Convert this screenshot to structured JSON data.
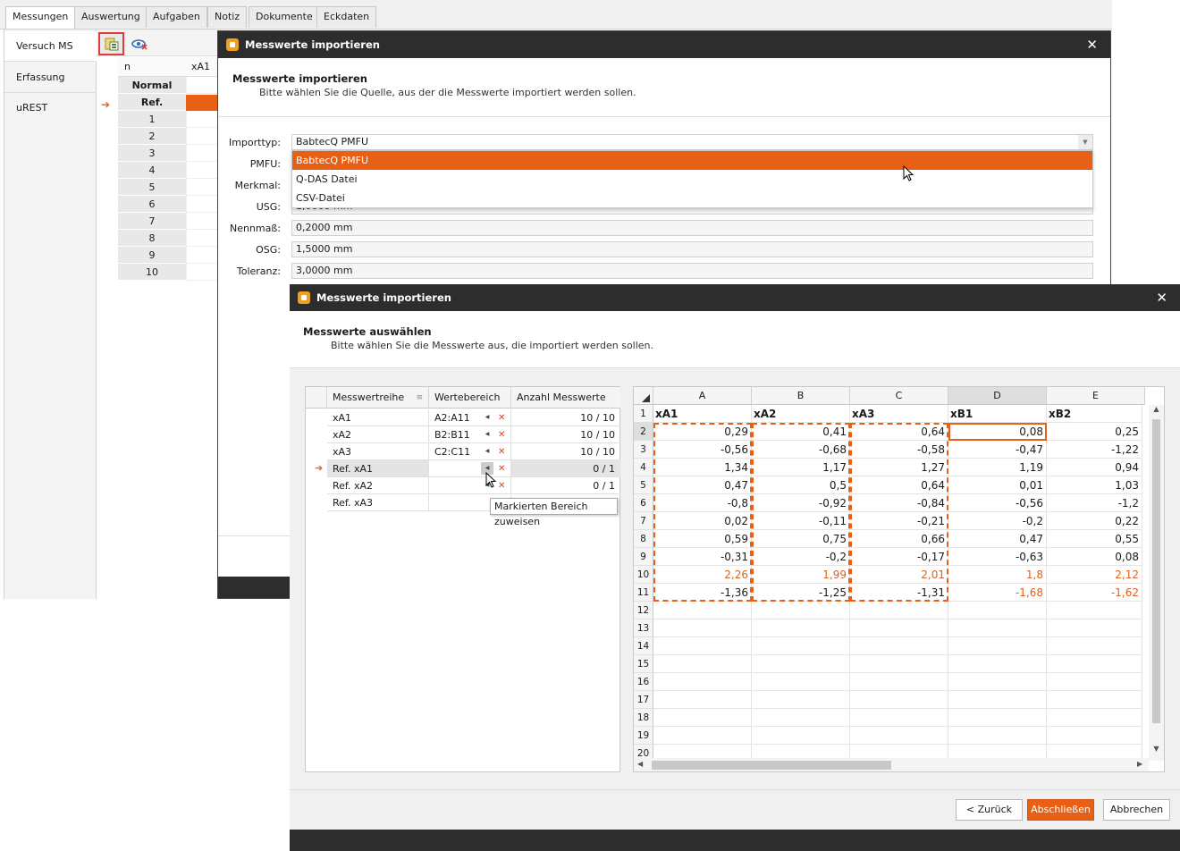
{
  "app": {
    "tabs": [
      "Messungen",
      "Auswertung",
      "Aufgaben",
      "Notiz",
      "Dokumente",
      "Eckdaten"
    ],
    "left_items": [
      "Versuch MS",
      "Erfassung uREST"
    ],
    "grid_head": [
      "n",
      "xA1"
    ],
    "grid_rows": [
      "Normal",
      "Ref.",
      "1",
      "2",
      "3",
      "4",
      "5",
      "6",
      "7",
      "8",
      "9",
      "10"
    ]
  },
  "dialog1": {
    "title": "Messwerte importieren",
    "heading": "Messwerte importieren",
    "subheading": "Bitte wählen Sie die Quelle, aus der die Messwerte importiert werden sollen.",
    "fields": [
      {
        "label": "Importtyp:",
        "value": "BabtecQ PMFU"
      },
      {
        "label": "PMFU:",
        "value": ""
      },
      {
        "label": "Merkmal:",
        "value": ""
      },
      {
        "label": "USG:",
        "value": "1,0000 mm"
      },
      {
        "label": "Nennmaß:",
        "value": "0,2000 mm"
      },
      {
        "label": "OSG:",
        "value": "1,5000 mm"
      },
      {
        "label": "Toleranz:",
        "value": "3,0000 mm"
      }
    ],
    "dropdown_options": [
      "BabtecQ PMFU",
      "Q-DAS Datei",
      "CSV-Datei"
    ],
    "selected_option": "BabtecQ PMFU"
  },
  "dialog2": {
    "title": "Messwerte importieren",
    "heading": "Messwerte auswählen",
    "subheading": "Bitte wählen Sie die Messwerte aus, die importiert werden sollen.",
    "table_headers": [
      "Messwertreihe",
      "Wertebereich",
      "Anzahl Messwerte"
    ],
    "rows": [
      {
        "name": "xA1",
        "range": "A2:A11",
        "count": "10 / 10"
      },
      {
        "name": "xA2",
        "range": "B2:B11",
        "count": "10 / 10"
      },
      {
        "name": "xA3",
        "range": "C2:C11",
        "count": "10 / 10"
      },
      {
        "name": "Ref. xA1",
        "range": "",
        "count": "0 / 1"
      },
      {
        "name": "Ref. xA2",
        "range": "",
        "count": "0 / 1"
      },
      {
        "name": "Ref. xA3",
        "range": "",
        "count": ""
      }
    ],
    "tooltip": "Markierten Bereich zuweisen",
    "sheet": {
      "columns": [
        "A",
        "B",
        "C",
        "D",
        "E"
      ],
      "header_row": [
        "xA1",
        "xA2",
        "xA3",
        "xB1",
        "xB2"
      ],
      "data": [
        [
          "0,29",
          "0,41",
          "0,64",
          "0,08",
          "0,25"
        ],
        [
          "-0,56",
          "-0,68",
          "-0,58",
          "-0,47",
          "-1,22"
        ],
        [
          "1,34",
          "1,17",
          "1,27",
          "1,19",
          "0,94"
        ],
        [
          "0,47",
          "0,5",
          "0,64",
          "0,01",
          "1,03"
        ],
        [
          "-0,8",
          "-0,92",
          "-0,84",
          "-0,56",
          "-1,2"
        ],
        [
          "0,02",
          "-0,11",
          "-0,21",
          "-0,2",
          "0,22"
        ],
        [
          "0,59",
          "0,75",
          "0,66",
          "0,47",
          "0,55"
        ],
        [
          "-0,31",
          "-0,2",
          "-0,17",
          "-0,63",
          "0,08"
        ],
        [
          "2,26",
          "1,99",
          "2,01",
          "1,8",
          "2,12"
        ],
        [
          "-1,36",
          "-1,25",
          "-1,31",
          "-1,68",
          "-1,62"
        ]
      ],
      "row_numbers": [
        "1",
        "2",
        "3",
        "4",
        "5",
        "6",
        "7",
        "8",
        "9",
        "10",
        "11",
        "12",
        "13",
        "14",
        "15",
        "16",
        "17",
        "18",
        "19",
        "20"
      ]
    },
    "buttons": {
      "back": "< Zurück",
      "finish": "Abschließen",
      "cancel": "Abbrechen"
    },
    "colors": {
      "accent": "#e86016",
      "titlebar": "#2d2d2d"
    }
  }
}
